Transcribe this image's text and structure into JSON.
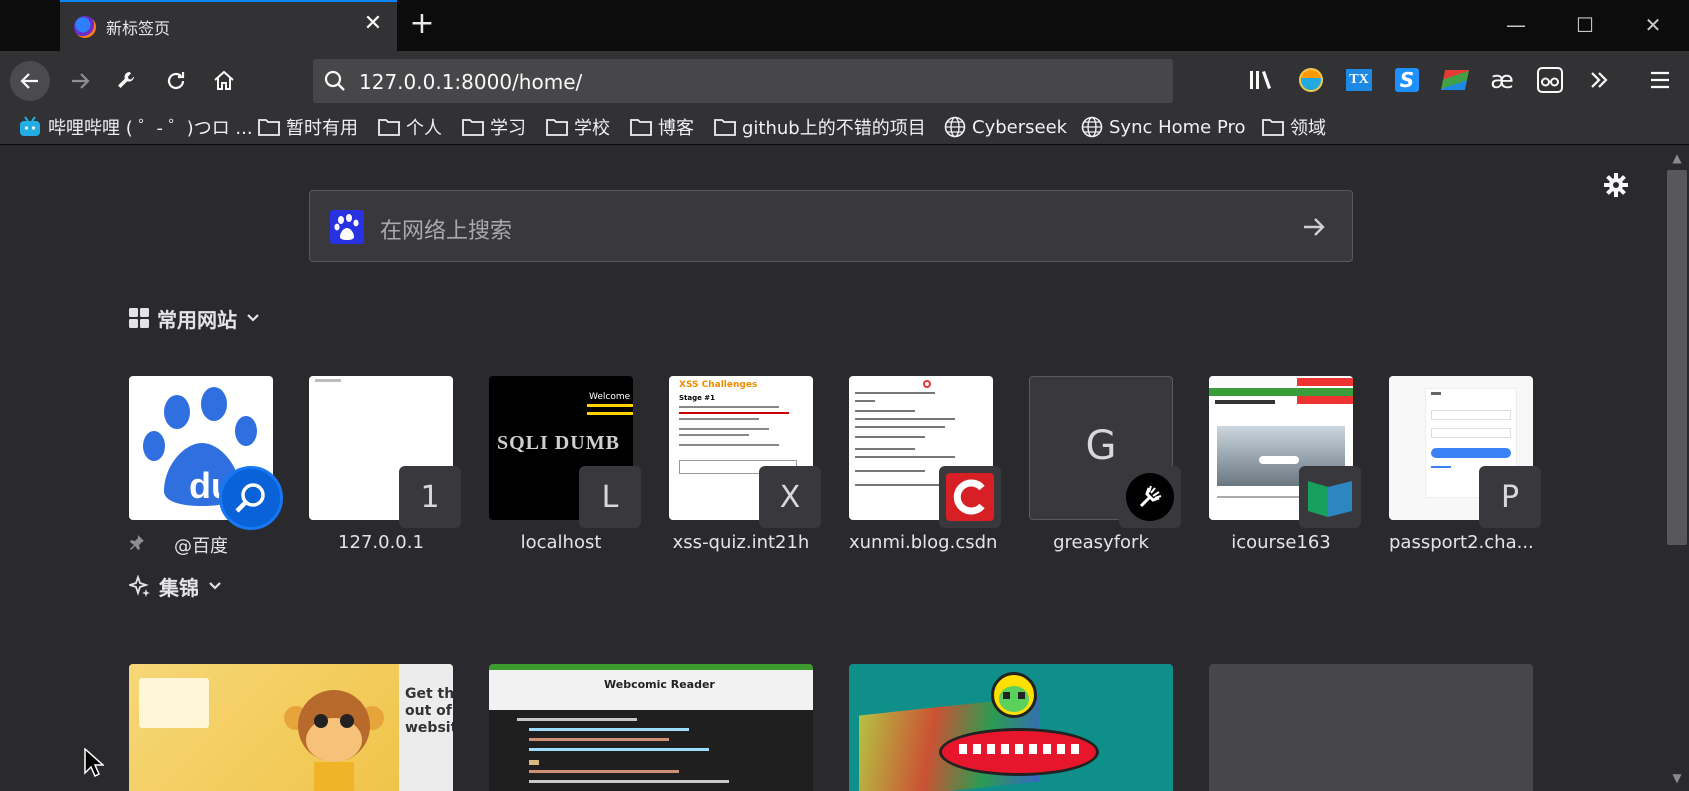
{
  "tab": {
    "title": "新标签页"
  },
  "address": {
    "url": "127.0.0.1:8000/home/"
  },
  "bookmarks": [
    {
      "label": "哔哩哔哩 ( ゜- ゜)つロ ...",
      "icon": "bilibili-icon"
    },
    {
      "label": "暂时有用",
      "icon": "folder-icon"
    },
    {
      "label": "个人",
      "icon": "folder-icon"
    },
    {
      "label": "学习",
      "icon": "folder-icon"
    },
    {
      "label": "学校",
      "icon": "folder-icon"
    },
    {
      "label": "博客",
      "icon": "folder-icon"
    },
    {
      "label": "github上的不错的项目",
      "icon": "folder-icon"
    },
    {
      "label": "Cyberseek",
      "icon": "globe-icon"
    },
    {
      "label": "Sync Home Pro",
      "icon": "globe-icon"
    },
    {
      "label": "领域",
      "icon": "folder-icon"
    }
  ],
  "search": {
    "placeholder": "在网络上搜索"
  },
  "top_sites": {
    "heading": "常用网站",
    "tiles": [
      {
        "label": "@百度",
        "badge": ""
      },
      {
        "label": "127.0.0.1",
        "badge": "1"
      },
      {
        "label": "localhost",
        "badge": "L"
      },
      {
        "label": "xss-quiz.int21h",
        "badge": "X"
      },
      {
        "label": "xunmi.blog.csdn",
        "badge": ""
      },
      {
        "label": "greasyfork",
        "badge": ""
      },
      {
        "label": "icourse163",
        "badge": ""
      },
      {
        "label": "passport2.cha...",
        "badge": "P"
      }
    ]
  },
  "thumb_text": {
    "greasyfork_letter": "G",
    "sqli": "SQLI DUMB",
    "sqli_welcome": "Welcome",
    "xss_title": "XSS Challenges",
    "xss_stage": "Stage #1",
    "hl1_text": "Get the\nout of e\nwebsite",
    "hl2_title": "Webcomic Reader"
  },
  "highlights": {
    "heading": "集锦"
  }
}
